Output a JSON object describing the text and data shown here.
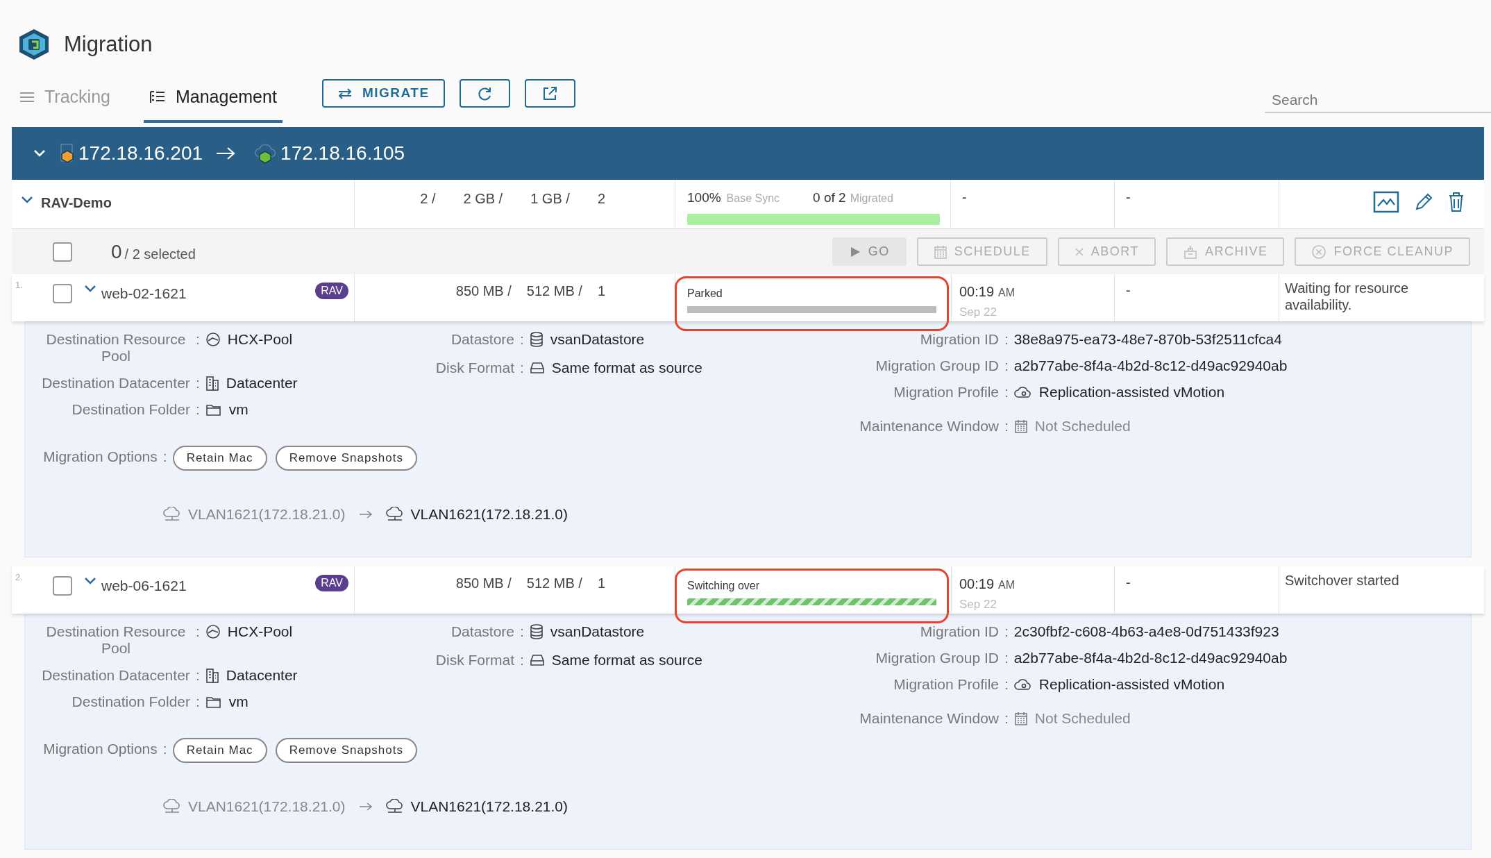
{
  "app": {
    "title": "Migration"
  },
  "tabs": [
    {
      "label": "Tracking",
      "selected": false
    },
    {
      "label": "Management",
      "selected": true
    }
  ],
  "toolbar": {
    "migrate_label": "MIGRATE"
  },
  "search": {
    "placeholder": "Search"
  },
  "site_pair": {
    "expanded": true,
    "source": "172.18.16.201",
    "destination": "172.18.16.105"
  },
  "group": {
    "name": "RAV-Demo",
    "expanded": true,
    "vm_count": "2 /",
    "storage": "2 GB /",
    "memory": "1 GB /",
    "cpu": "2",
    "sync_percent": "100%",
    "sync_label": "Base Sync",
    "migrated_count": "0 of 2",
    "migrated_label": "Migrated",
    "level": 1,
    "column_5": "-",
    "column_6": "-"
  },
  "selection": {
    "checked": false,
    "count": "0",
    "total": "/ 2 selected"
  },
  "actions": [
    {
      "kind": "go",
      "label": "GO",
      "disabled": true
    },
    {
      "kind": "schedule",
      "label": "SCHEDULE",
      "disabled": true
    },
    {
      "kind": "abort",
      "label": "ABORT",
      "disabled": true
    },
    {
      "kind": "archive",
      "label": "ARCHIVE",
      "disabled": true
    },
    {
      "kind": "cleanup",
      "label": "FORCE CLEANUP",
      "disabled": true
    }
  ],
  "vms": [
    {
      "index": "1.",
      "checked": false,
      "expanded": true,
      "name": "web-02-1621",
      "badge": "RAV",
      "storage": "850 MB /",
      "memory": "512 MB /",
      "cpu": "1",
      "status": "Parked",
      "kind": "parked",
      "level": 1,
      "highlighted": true,
      "time": "00:19",
      "meridiem": "AM",
      "date": "Sep 22",
      "column_5": "-",
      "message": "Waiting for resource availability.",
      "details": {
        "resource_pool": {
          "label": "Destination Resource Pool",
          "colon": ":",
          "value": "HCX-Pool"
        },
        "datacenter": {
          "label": "Destination Datacenter",
          "colon": ":",
          "value": "Datacenter"
        },
        "folder": {
          "label": "Destination Folder",
          "colon": ":",
          "value": "vm"
        },
        "options": {
          "label": "Migration Options",
          "colon": ":",
          "values": [
            "Retain Mac",
            "Remove Snapshots"
          ]
        },
        "datastore": {
          "label": "Datastore",
          "colon": ":",
          "value": "vsanDatastore"
        },
        "disk_format": {
          "label": "Disk Format",
          "colon": ":",
          "value": "Same format as source"
        },
        "migration_id": {
          "label": "Migration ID",
          "colon": ":",
          "value": "38e8a975-ea73-48e7-870b-53f2511cfca4"
        },
        "group_id": {
          "label": "Migration Group ID",
          "colon": ":",
          "value": "a2b77abe-8f4a-4b2d-8c12-d49ac92940ab"
        },
        "profile": {
          "label": "Migration Profile",
          "colon": ":",
          "value": "Replication-assisted vMotion"
        },
        "maintenance": {
          "label": "Maintenance Window",
          "colon": ":",
          "value": "Not Scheduled"
        },
        "network": {
          "source": "VLAN1621(172.18.21.0)",
          "destination": "VLAN1621(172.18.21.0)"
        }
      }
    },
    {
      "index": "2.",
      "checked": false,
      "expanded": true,
      "name": "web-06-1621",
      "badge": "RAV",
      "storage": "850 MB /",
      "memory": "512 MB /",
      "cpu": "1",
      "status": "Switching over",
      "kind": "switching",
      "level": 1,
      "highlighted": true,
      "time": "00:19",
      "meridiem": "AM",
      "date": "Sep 22",
      "column_5": "-",
      "message": "Switchover started",
      "details": {
        "resource_pool": {
          "label": "Destination Resource Pool",
          "colon": ":",
          "value": "HCX-Pool"
        },
        "datacenter": {
          "label": "Destination Datacenter",
          "colon": ":",
          "value": "Datacenter"
        },
        "folder": {
          "label": "Destination Folder",
          "colon": ":",
          "value": "vm"
        },
        "options": {
          "label": "Migration Options",
          "colon": ":",
          "values": [
            "Retain Mac",
            "Remove Snapshots"
          ]
        },
        "datastore": {
          "label": "Datastore",
          "colon": ":",
          "value": "vsanDatastore"
        },
        "disk_format": {
          "label": "Disk Format",
          "colon": ":",
          "value": "Same format as source"
        },
        "migration_id": {
          "label": "Migration ID",
          "colon": ":",
          "value": "2c30fbf2-c608-4b63-a4e8-0d751433f923"
        },
        "group_id": {
          "label": "Migration Group ID",
          "colon": ":",
          "value": "a2b77abe-8f4a-4b2d-8c12-d49ac92940ab"
        },
        "profile": {
          "label": "Migration Profile",
          "colon": ":",
          "value": "Replication-assisted vMotion"
        },
        "maintenance": {
          "label": "Maintenance Window",
          "colon": ":",
          "value": "Not Scheduled"
        },
        "network": {
          "source": "VLAN1621(172.18.21.0)",
          "destination": "VLAN1621(172.18.21.0)"
        }
      }
    }
  ]
}
